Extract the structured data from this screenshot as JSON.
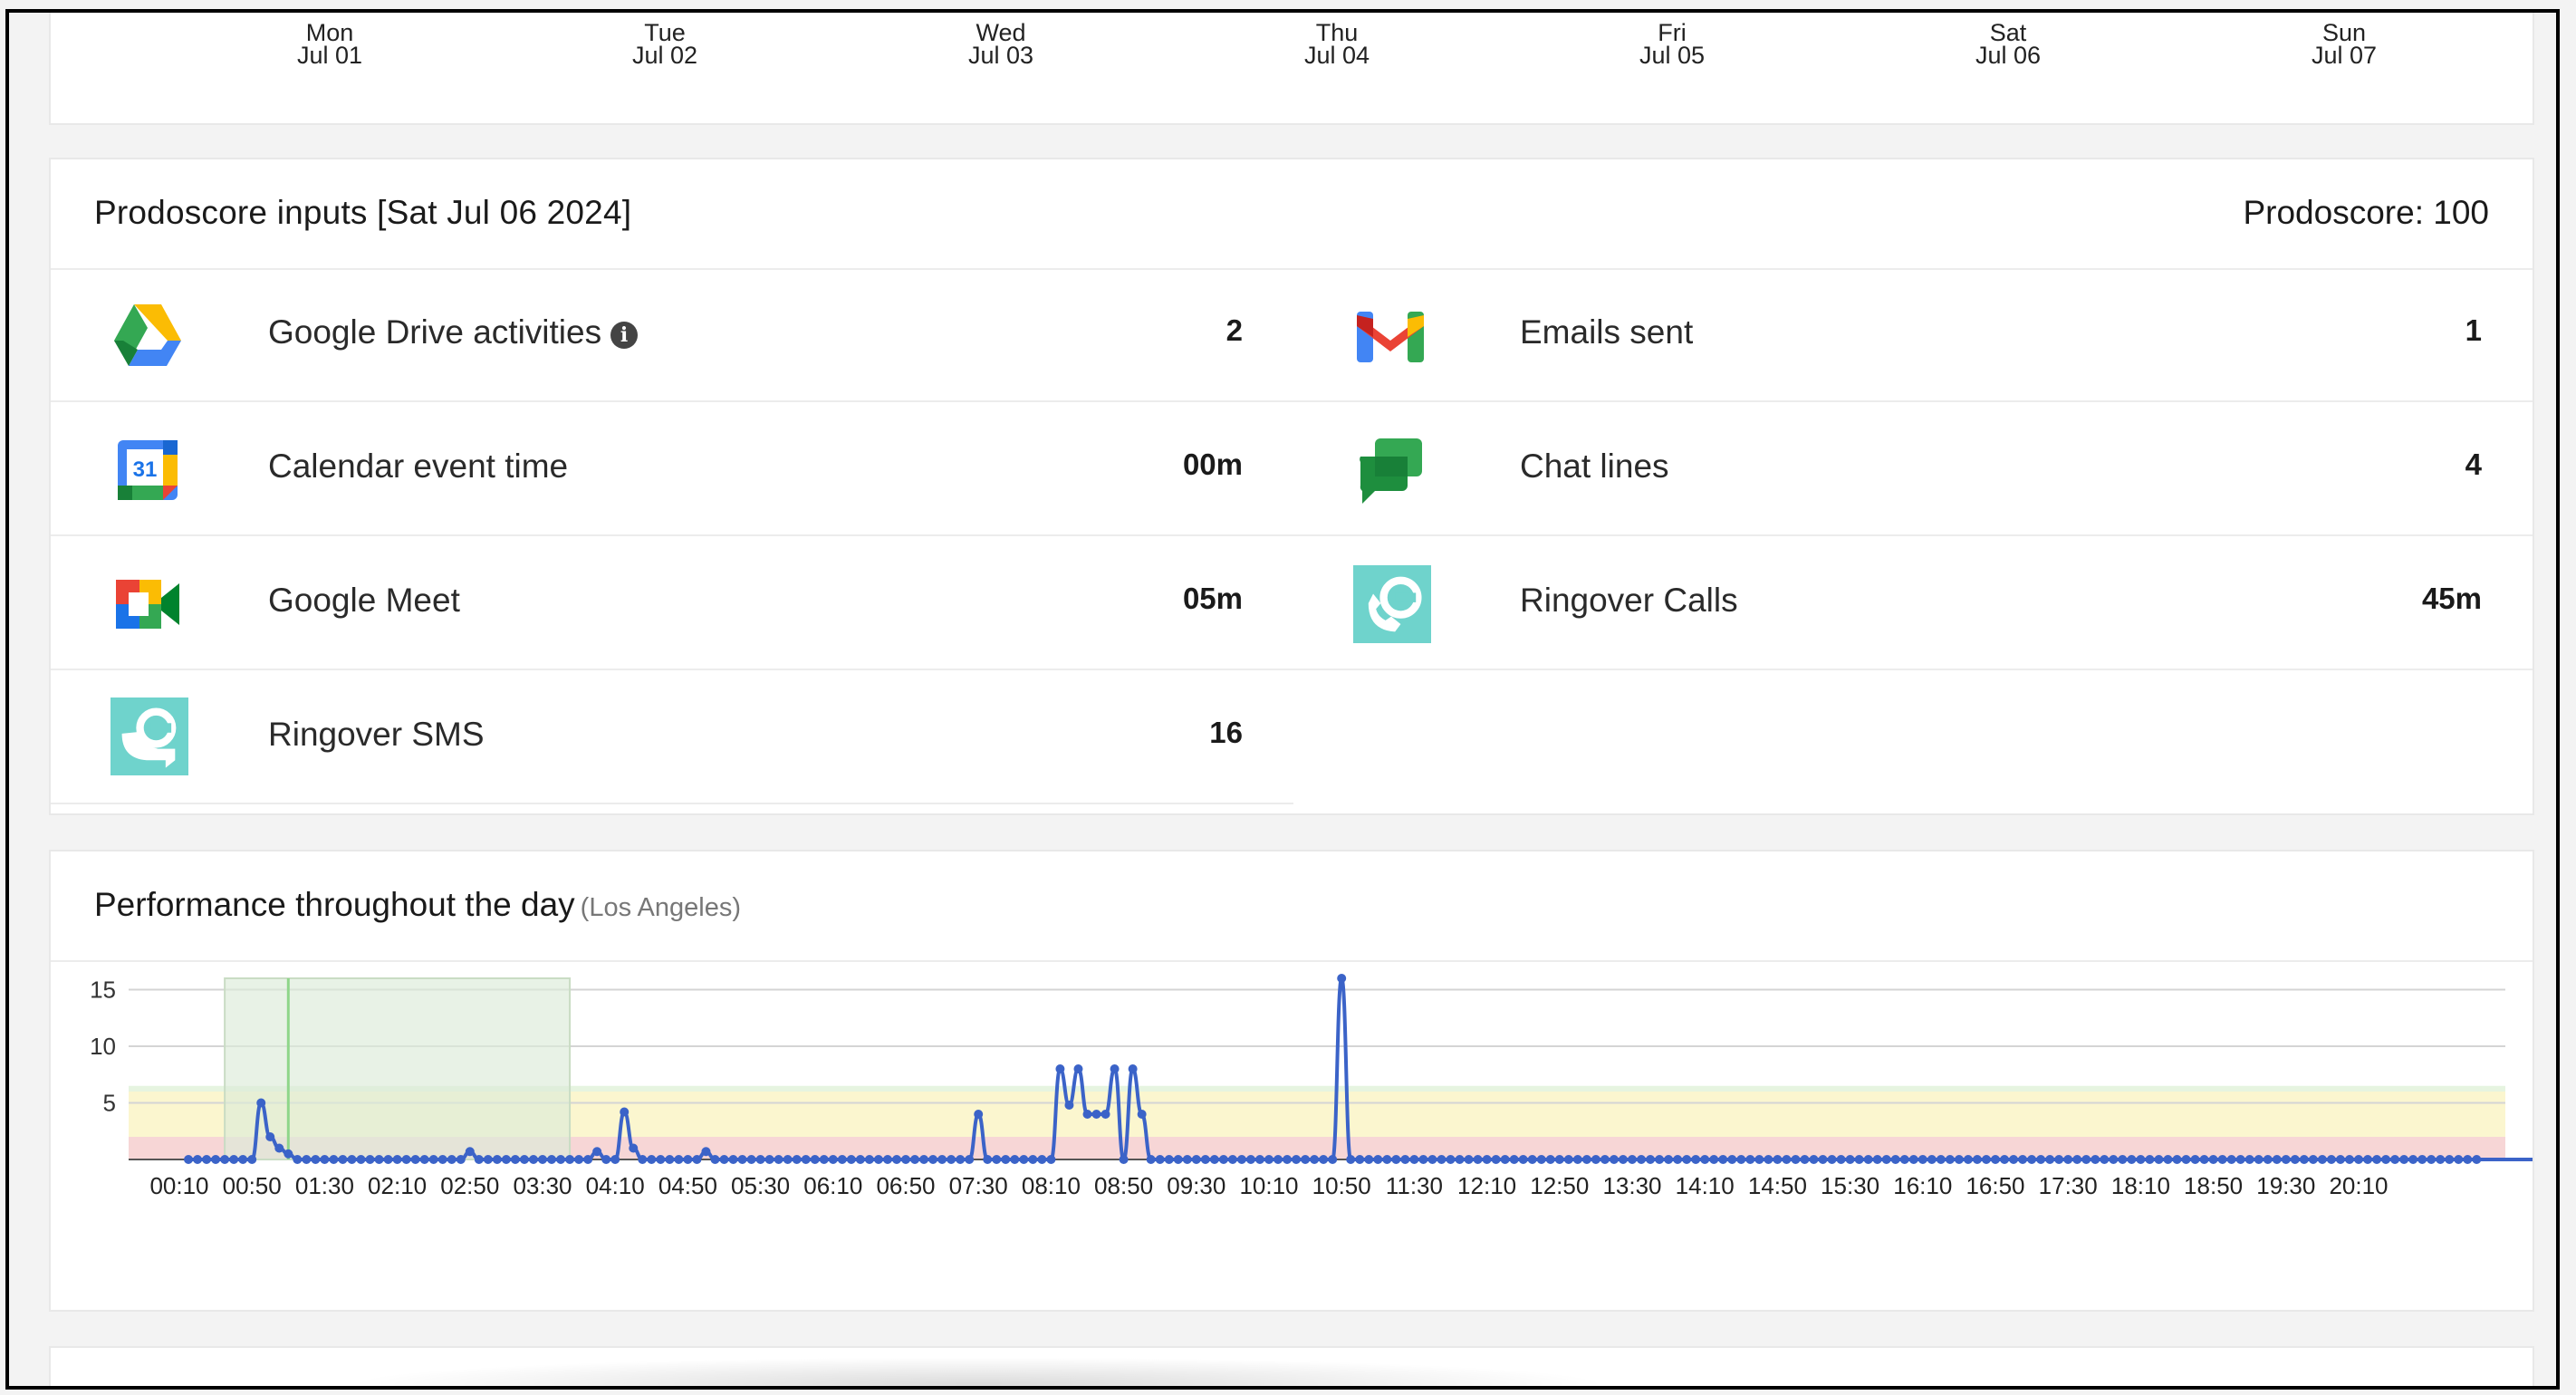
{
  "week_days": [
    {
      "dow": "Mon",
      "date": "Jul 01"
    },
    {
      "dow": "Tue",
      "date": "Jul 02"
    },
    {
      "dow": "Wed",
      "date": "Jul 03"
    },
    {
      "dow": "Thu",
      "date": "Jul 04"
    },
    {
      "dow": "Fri",
      "date": "Jul 05"
    },
    {
      "dow": "Sat",
      "date": "Jul 06"
    },
    {
      "dow": "Sun",
      "date": "Jul 07"
    }
  ],
  "inputs": {
    "title": "Prodoscore inputs [Sat Jul 06 2024]",
    "score_label": "Prodoscore: 100",
    "items": [
      {
        "label": "Google Drive activities",
        "value": "2",
        "icon": "google-drive-icon"
      },
      {
        "label": "Emails sent",
        "value": "1",
        "icon": "gmail-icon"
      },
      {
        "label": "Calendar event time",
        "value": "00m",
        "icon": "google-calendar-icon"
      },
      {
        "label": "Chat lines",
        "value": "4",
        "icon": "google-chat-icon"
      },
      {
        "label": "Google Meet",
        "value": "05m",
        "icon": "google-meet-icon"
      },
      {
        "label": "Ringover Calls",
        "value": "45m",
        "icon": "ringover-calls-icon"
      },
      {
        "label": "Ringover SMS",
        "value": "16",
        "icon": "ringover-sms-icon"
      }
    ],
    "info_glyph": "i"
  },
  "performance": {
    "title": "Performance throughout the day",
    "subtitle": "(Los Angeles)"
  },
  "colors": {
    "line": "#3b63c8",
    "band_low": "#f7d6d6",
    "band_mid": "#fbf6cf",
    "band_high": "#e6f4e0",
    "highlight": "#dcebd8",
    "highlight_line": "#8fd68a"
  },
  "chart_data": {
    "type": "line",
    "ylim": [
      0,
      16
    ],
    "y_ticks": [
      5,
      10,
      15
    ],
    "x_tick_labels": [
      "00:10",
      "00:50",
      "01:30",
      "02:10",
      "02:50",
      "03:30",
      "04:10",
      "04:50",
      "05:30",
      "06:10",
      "06:50",
      "07:30",
      "08:10",
      "08:50",
      "09:30",
      "10:10",
      "10:50",
      "11:30",
      "12:10",
      "12:50",
      "13:30",
      "14:10",
      "14:50",
      "15:30",
      "16:10",
      "16:50",
      "17:30",
      "18:10",
      "18:50",
      "19:30",
      "20:10"
    ],
    "highlight_range": [
      "00:35",
      "03:45"
    ],
    "highlight_line": "01:10",
    "bands": [
      {
        "from": 0,
        "to": 2,
        "level": "low"
      },
      {
        "from": 2,
        "to": 6,
        "level": "mid"
      },
      {
        "from": 6,
        "to": 6.5,
        "level": "high"
      }
    ],
    "interval_minutes": 5,
    "x_start": "00:00",
    "series": [
      {
        "values": [
          0,
          0,
          0,
          0,
          0,
          0,
          0,
          0,
          5,
          2,
          1,
          0.5,
          0,
          0,
          0,
          0,
          0,
          0,
          0,
          0,
          0,
          0,
          0,
          0,
          0,
          0,
          0,
          0,
          0,
          0,
          0,
          0.7,
          0,
          0,
          0,
          0,
          0,
          0,
          0,
          0,
          0,
          0,
          0,
          0,
          0,
          0.7,
          0,
          0,
          4.2,
          1,
          0,
          0,
          0,
          0,
          0,
          0,
          0,
          0.7,
          0,
          0,
          0,
          0,
          0,
          0,
          0,
          0,
          0,
          0,
          0,
          0,
          0,
          0,
          0,
          0,
          0,
          0,
          0,
          0,
          0,
          0,
          0,
          0,
          0,
          0,
          0,
          0,
          0,
          4,
          0,
          0,
          0,
          0,
          0,
          0,
          0,
          0,
          8,
          4.8,
          8,
          4,
          4,
          4,
          8,
          0,
          8,
          4,
          0,
          0,
          0,
          0,
          0,
          0,
          0,
          0,
          0,
          0,
          0,
          0,
          0,
          0,
          0,
          0,
          0,
          0,
          0,
          0,
          0,
          16,
          0,
          0,
          0,
          0,
          0,
          0,
          0,
          0,
          0,
          0,
          0,
          0,
          0,
          0,
          0,
          0,
          0,
          0,
          0,
          0,
          0,
          0,
          0,
          0,
          0,
          0,
          0,
          0,
          0,
          0,
          0,
          0,
          0,
          0,
          0,
          0,
          0,
          0,
          0,
          0,
          0,
          0,
          0,
          0,
          0,
          0,
          0,
          0,
          0,
          0,
          0,
          0,
          0,
          0,
          0,
          0,
          0,
          0,
          0,
          0,
          0,
          0,
          0,
          0,
          0,
          0,
          0,
          0,
          0,
          0,
          0,
          0,
          0,
          0,
          0,
          0,
          0,
          0,
          0,
          0,
          0,
          0,
          0,
          0,
          0,
          0,
          0,
          0,
          0,
          0,
          0,
          0,
          0,
          0,
          0,
          0,
          0,
          0,
          0,
          0,
          0,
          0,
          0,
          0,
          0,
          0,
          0,
          0,
          0,
          0,
          0,
          0,
          0,
          0,
          0,
          0,
          0,
          0,
          0,
          0,
          0,
          0,
          0,
          0,
          0,
          0,
          0,
          0,
          0,
          0,
          0,
          0,
          0,
          0,
          0
        ]
      }
    ]
  }
}
